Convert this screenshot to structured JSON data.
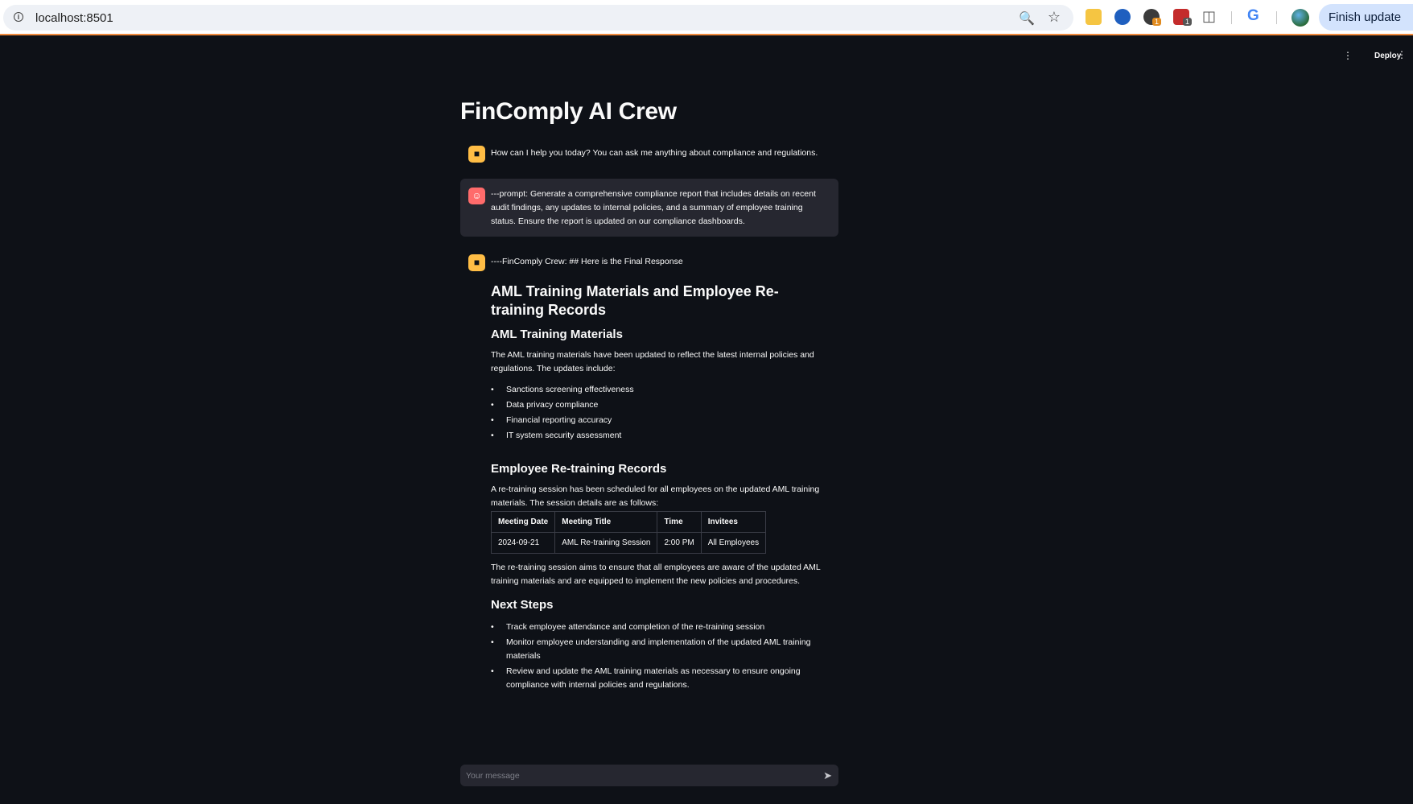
{
  "browser": {
    "url": "localhost:8501",
    "finish_update": "Finish update",
    "ext_badge_a": "1",
    "ext_badge_b": "1",
    "google_letter": "G"
  },
  "header": {
    "deploy_label": "Deploy"
  },
  "page": {
    "title": "FinComply AI Crew"
  },
  "messages": {
    "greeting": "How can I help you today? You can ask me anything about compliance and regulations.",
    "user_prompt": "---prompt: Generate a comprehensive compliance report that includes details on recent audit findings, any updates to internal policies, and a summary of employee training status. Ensure the report is updated on our compliance dashboards.",
    "response_intro": "----FinComply Crew: ## Here is the Final Response"
  },
  "response": {
    "h2": "AML Training Materials and Employee Re-training Records",
    "sec1_title": "AML Training Materials",
    "sec1_para": "The AML training materials have been updated to reflect the latest internal policies and regulations. The updates include:",
    "sec1_items": [
      "Sanctions screening effectiveness",
      "Data privacy compliance",
      "Financial reporting accuracy",
      "IT system security assessment"
    ],
    "sec2_title": "Employee Re-training Records",
    "sec2_para": "A re-training session has been scheduled for all employees on the updated AML training materials. The session details are as follows:",
    "table": {
      "headers": [
        "Meeting Date",
        "Meeting Title",
        "Time",
        "Invitees"
      ],
      "rows": [
        [
          "2024-09-21",
          "AML Re-training Session",
          "2:00 PM",
          "All Employees"
        ]
      ]
    },
    "sec2_after": "The re-training session aims to ensure that all employees are aware of the updated AML training materials and are equipped to implement the new policies and procedures.",
    "sec3_title": "Next Steps",
    "sec3_items": [
      "Track employee attendance and completion of the re-training session",
      "Monitor employee understanding and implementation of the updated AML training materials",
      "Review and update the AML training materials as necessary to ensure ongoing compliance with internal policies and regulations."
    ]
  },
  "chat_input": {
    "placeholder": "Your message"
  },
  "colors": {
    "background": "#0e1117",
    "bot_avatar": "#ffbd45",
    "user_avatar": "#ff6b6b",
    "user_bubble": "#262730"
  },
  "icons": {
    "bot_avatar": "robot-face-icon",
    "user_avatar": "smiley-face-icon",
    "send": "send-arrow-icon"
  }
}
